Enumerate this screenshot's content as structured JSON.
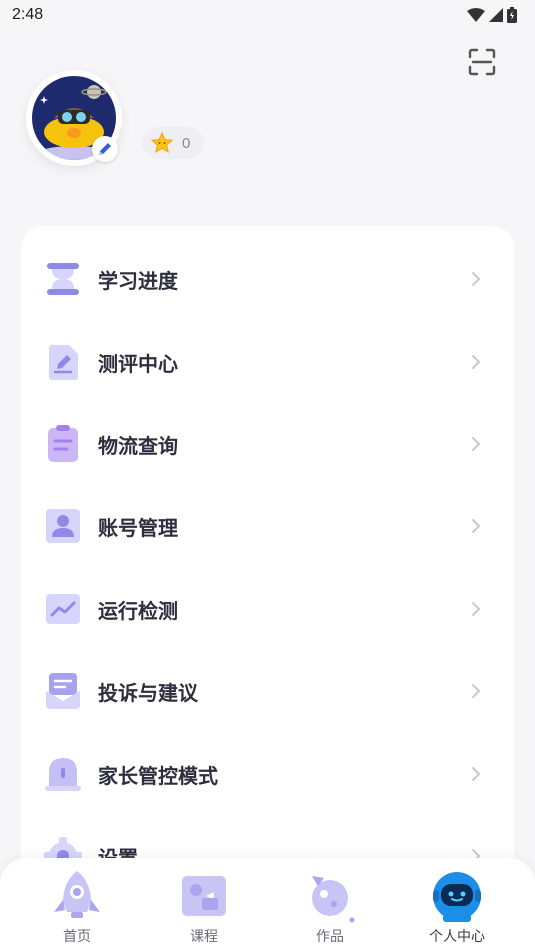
{
  "status_bar": {
    "time": "2:48"
  },
  "profile": {
    "stars": "0"
  },
  "menu": {
    "items": [
      {
        "label": "学习进度",
        "icon": "hourglass-icon"
      },
      {
        "label": "测评中心",
        "icon": "test-document-icon"
      },
      {
        "label": "物流查询",
        "icon": "clipboard-icon"
      },
      {
        "label": "账号管理",
        "icon": "account-icon"
      },
      {
        "label": "运行检测",
        "icon": "chart-line-icon"
      },
      {
        "label": "投诉与建议",
        "icon": "feedback-icon"
      },
      {
        "label": "家长管控模式",
        "icon": "parental-control-icon"
      },
      {
        "label": "设置",
        "icon": "gear-icon"
      }
    ]
  },
  "bottom_nav": {
    "items": [
      {
        "label": "首页",
        "icon": "rocket-icon"
      },
      {
        "label": "课程",
        "icon": "course-icon"
      },
      {
        "label": "作品",
        "icon": "planet-icon"
      },
      {
        "label": "个人中心",
        "icon": "robot-icon",
        "active": true
      }
    ]
  },
  "colors": {
    "accent": "#a8a4f2",
    "accent_dark": "#7c78e0",
    "icon_light": "#d7d5fb",
    "robot_blue": "#2fa3f5"
  }
}
